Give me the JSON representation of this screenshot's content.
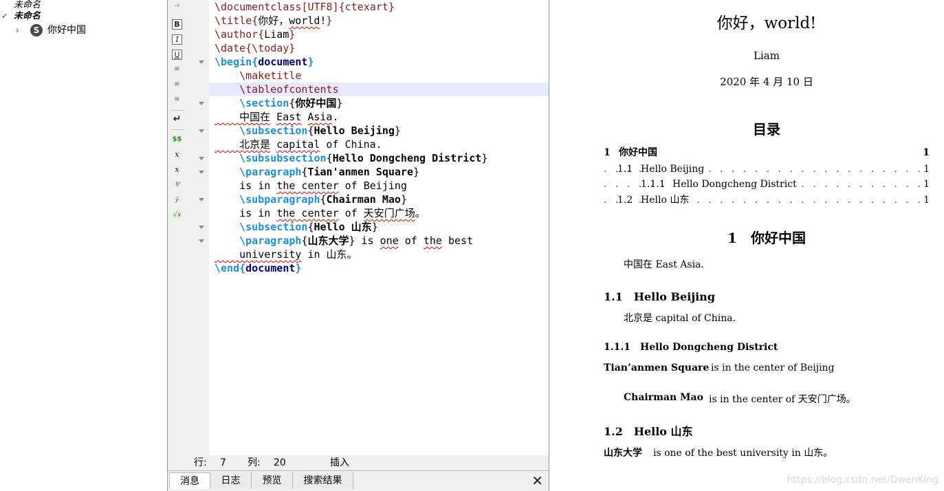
{
  "tree": {
    "row1": "未命名",
    "row2": "未命名",
    "check": "✓",
    "chevron": "›",
    "item_icon_letter": "S",
    "item_label": "你好中国"
  },
  "toolbar": {
    "bold": "B",
    "italic": "I",
    "underline": "U",
    "newline": "↵",
    "math": "$$",
    "subscript": "x",
    "superscript": "x",
    "sqrt": "√x"
  },
  "code": [
    [
      [
        "cmd",
        "\\documentclass"
      ],
      [
        "cmd",
        "[UTF8]{ctexart}"
      ]
    ],
    [
      [
        "cmd",
        "\\title"
      ],
      [
        "cmd",
        "{"
      ],
      [
        "txt",
        "你好，"
      ],
      [
        "sq",
        "world"
      ],
      [
        "txt",
        "!"
      ],
      [
        "cmd",
        "}"
      ]
    ],
    [
      [
        "cmd",
        "\\author"
      ],
      [
        "cmd",
        "{"
      ],
      [
        "txt",
        "Liam"
      ],
      [
        "cmd",
        "}"
      ]
    ],
    [
      [
        "cmd",
        "\\date"
      ],
      [
        "cmd",
        "{\\today}"
      ]
    ],
    [
      [
        "kw",
        "\\begin"
      ],
      [
        "kw",
        "{"
      ],
      [
        "env",
        "document"
      ],
      [
        "kw",
        "}"
      ]
    ],
    [
      [
        "cmd",
        "    \\maketitle"
      ]
    ],
    [
      [
        "cmd",
        "    \\tableofcontents"
      ]
    ],
    [
      [
        "kw",
        "    \\section"
      ],
      [
        "txt",
        "{"
      ],
      [
        "arg",
        "你好中国"
      ],
      [
        "txt",
        "}"
      ]
    ],
    [
      [
        "sq",
        "    中国在"
      ],
      [
        "txt",
        " "
      ],
      [
        "sq",
        "East"
      ],
      [
        "txt",
        " "
      ],
      [
        "sq",
        "Asia"
      ],
      [
        "txt",
        "."
      ]
    ],
    [
      [
        "kw",
        "    \\subsection"
      ],
      [
        "txt",
        "{"
      ],
      [
        "arg",
        "Hello Beijing"
      ],
      [
        "txt",
        "}"
      ]
    ],
    [
      [
        "sq",
        "    北京是"
      ],
      [
        "txt",
        " "
      ],
      [
        "sq",
        "capital"
      ],
      [
        "txt",
        " of China."
      ]
    ],
    [
      [
        "kw",
        "    \\subsubsection"
      ],
      [
        "txt",
        "{"
      ],
      [
        "arg",
        "Hello Dongcheng District"
      ],
      [
        "txt",
        "}"
      ]
    ],
    [
      [
        "kw",
        "    \\paragraph"
      ],
      [
        "txt",
        "{"
      ],
      [
        "arg",
        "Tian'anmen Square"
      ],
      [
        "txt",
        "}"
      ]
    ],
    [
      [
        "txt",
        "    is in "
      ],
      [
        "sq",
        "the center"
      ],
      [
        "txt",
        " of Beijing"
      ]
    ],
    [
      [
        "kw",
        "    \\subparagraph"
      ],
      [
        "txt",
        "{"
      ],
      [
        "arg",
        "Chairman Mao"
      ],
      [
        "txt",
        "}"
      ]
    ],
    [
      [
        "txt",
        "    is in "
      ],
      [
        "sq",
        "the center"
      ],
      [
        "txt",
        " of "
      ],
      [
        "sq",
        "天安门广场"
      ],
      [
        "txt",
        "。"
      ]
    ],
    [
      [
        "kw",
        "    \\subsection"
      ],
      [
        "txt",
        "{"
      ],
      [
        "arg",
        "Hello 山东"
      ],
      [
        "txt",
        "}"
      ]
    ],
    [
      [
        "kw",
        "    \\paragraph"
      ],
      [
        "txt",
        "{"
      ],
      [
        "arg",
        "山东大学"
      ],
      [
        "txt",
        "} is "
      ],
      [
        "sq",
        "one"
      ],
      [
        "txt",
        " of "
      ],
      [
        "sq",
        "the"
      ],
      [
        "txt",
        " best"
      ]
    ],
    [
      [
        "sq",
        "    university"
      ],
      [
        "txt",
        " in 山东。"
      ]
    ],
    [
      [
        "kw",
        "\\end"
      ],
      [
        "kw",
        "{"
      ],
      [
        "env",
        "document"
      ],
      [
        "kw",
        "}"
      ]
    ]
  ],
  "status": {
    "row_label": "行:",
    "row_value": "7",
    "col_label": "列:",
    "col_value": "20",
    "mode": "插入"
  },
  "tabs": [
    "消息",
    "日志",
    "预览",
    "搜索结果"
  ],
  "close_symbol": "✕",
  "preview": {
    "title": "你好，world!",
    "author": "Liam",
    "date": "2020 年 4 月 10 日",
    "toc_heading": "目录",
    "toc": [
      {
        "num": "1",
        "title": "你好中国",
        "page": "1",
        "level": 0
      },
      {
        "num": "1.1",
        "title": "Hello Beijing",
        "page": "1",
        "level": 1
      },
      {
        "num": "1.1.1",
        "title": "Hello Dongcheng District",
        "page": "1",
        "level": 2
      },
      {
        "num": "1.2",
        "title": "Hello 山东",
        "page": "1",
        "level": 1
      }
    ],
    "sec1": "1　你好中国",
    "sec1_body": "中国在 East Asia.",
    "sub11": "1.1　Hello Beijing",
    "sub11_body": "北京是 capital of China.",
    "subsub111": "1.1.1　Hello Dongcheng District",
    "para_title": "Tian’anmen Square",
    "para_body": "is in the center of Beijing",
    "subpara_title": "Chairman Mao",
    "subpara_body": "is in the center of 天安门广场。",
    "sub12": "1.2　Hello 山东",
    "para2_title": "山东大学",
    "para2_body": "is one of the best university in 山东。"
  },
  "watermark": "https://blog.csdn.net/DwenKing"
}
